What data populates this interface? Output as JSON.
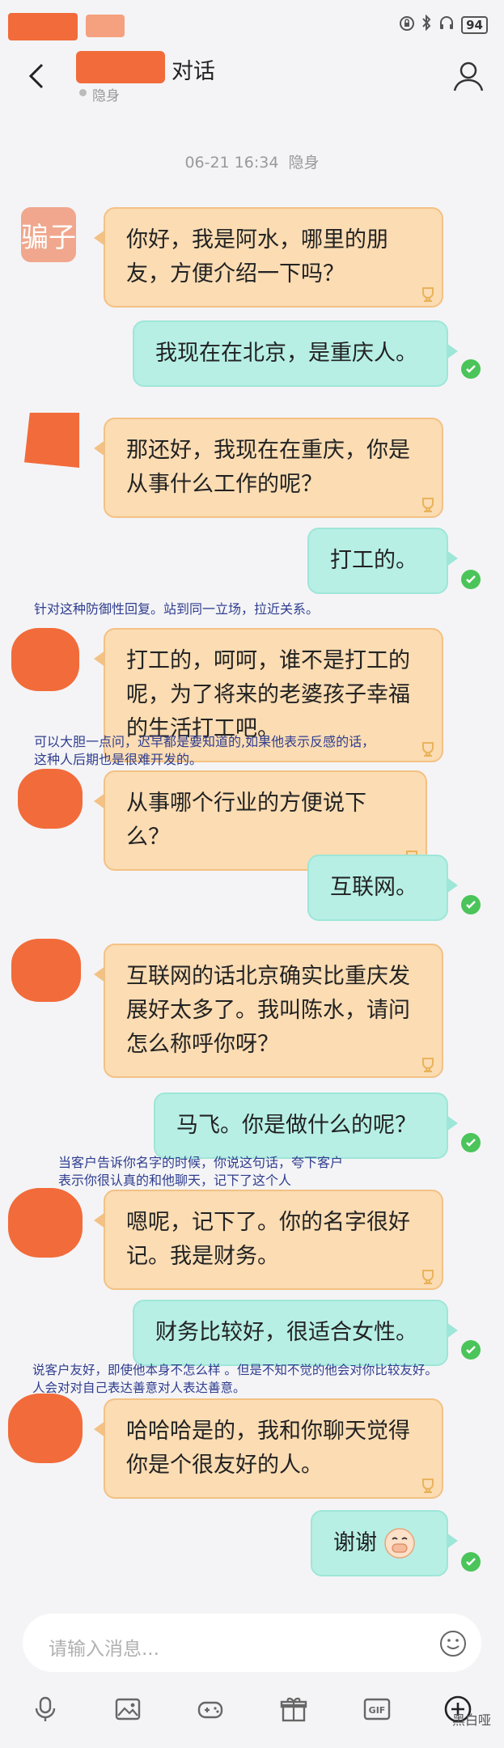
{
  "status_bar": {
    "battery": "94",
    "icons": [
      "lock-icon",
      "bluetooth-icon",
      "headphones-icon"
    ]
  },
  "header": {
    "title": "对话",
    "presence": "隐身"
  },
  "timestamp": {
    "date": "06-21 16:34",
    "presence": "隐身"
  },
  "avatar_label": "骗子",
  "messages": [
    {
      "side": "in",
      "text_lines": [
        "你好，我是阿水，哪里的朋",
        "友，方便介绍一下吗？"
      ]
    },
    {
      "side": "out",
      "text": "我现在在北京，是重庆人。"
    },
    {
      "side": "in",
      "text_lines": [
        "那还好，我现在在重庆，你是",
        "从事什么工作的呢？"
      ]
    },
    {
      "side": "out",
      "text": "打工的。"
    },
    {
      "side": "in",
      "text_lines": [
        "打工的，呵呵，谁不是打工的",
        "呢，为了将来的老婆孩子幸福",
        "的生活打工吧。"
      ]
    },
    {
      "side": "in",
      "text_lines": [
        "从事哪个行业的方便说下么？"
      ]
    },
    {
      "side": "out",
      "text": "互联网。"
    },
    {
      "side": "in",
      "text_lines": [
        "互联网的话北京确实比重庆发",
        "展好太多了。我叫陈水，请问",
        "怎么称呼你呀？"
      ]
    },
    {
      "side": "out",
      "text": "马飞。你是做什么的呢？"
    },
    {
      "side": "in",
      "text_lines": [
        "嗯呢，记下了。你的名字很好",
        "记。我是财务。"
      ]
    },
    {
      "side": "out",
      "text": "财务比较好，很适合女性。"
    },
    {
      "side": "in",
      "text_lines": [
        "哈哈哈是的，我和你聊天觉得",
        "你是个很友好的人。"
      ]
    },
    {
      "side": "out",
      "text": "谢谢"
    }
  ],
  "annotations": [
    {
      "lines": [
        "针对这种防御性回复。站到同一立场，拉近关系。"
      ]
    },
    {
      "lines": [
        "可以大胆一点问，迟早都是要知道的,如果他表示反感的话，",
        "这种人后期也是很难开发的。"
      ]
    },
    {
      "lines": [
        "当客户告诉你名字的时候，你说这句话，夸下客户",
        "表示你很认真的和他聊天，记下了这个人"
      ]
    },
    {
      "lines": [
        "说客户友好，即使他本身不怎么样 。但是不知不觉的他会对你比较友好。",
        "人会对对自己表达善意对人表达善意。"
      ]
    }
  ],
  "input": {
    "placeholder": "请输入消息..."
  },
  "toolbar": {
    "icons": [
      "microphone-icon",
      "image-icon",
      "gamepad-icon",
      "gift-icon",
      "gif-icon",
      "plus-icon"
    ],
    "gif_label": "GIF"
  },
  "watermark": "黑白哑",
  "colors": {
    "incoming_bubble": "#fbdcb3",
    "outgoing_bubble": "#b7efe5",
    "sent_check": "#4bc45a",
    "annotation_text": "#2f3d8f",
    "redaction": "#f26b3a"
  }
}
